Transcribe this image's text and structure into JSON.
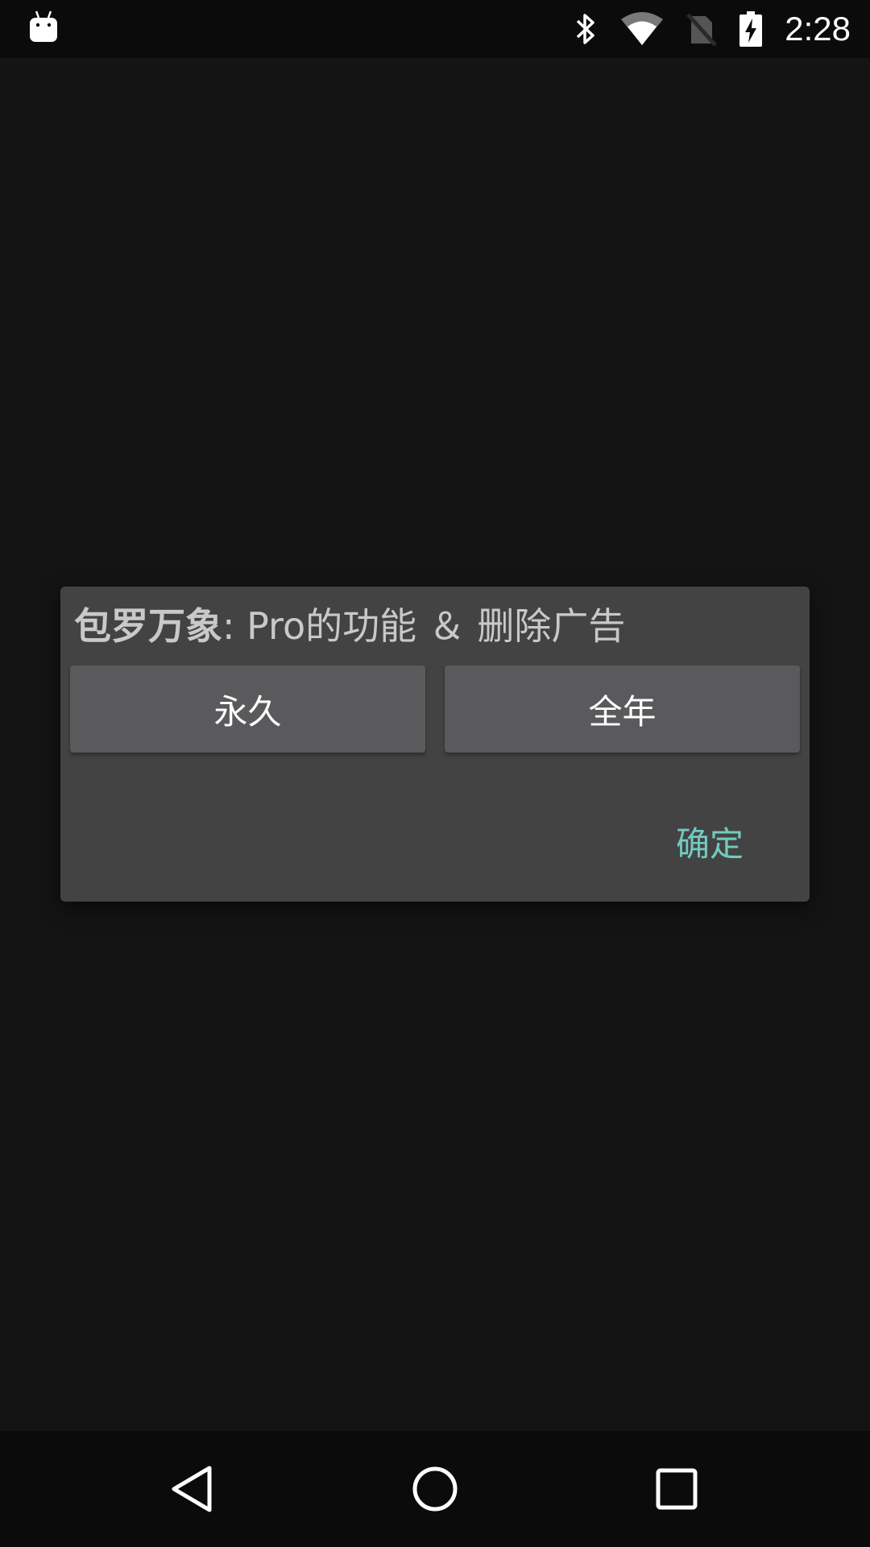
{
  "status_bar": {
    "time": "2:28",
    "icons": [
      "android-notification-icon",
      "bluetooth-icon",
      "wifi-icon",
      "no-sim-icon",
      "battery-charging-icon"
    ]
  },
  "dialog": {
    "title_app": "包罗万象",
    "title_rest": ": Pro的功能 ＆ 删除广告",
    "option_left": "永久",
    "option_right": "全年",
    "confirm": "确定",
    "accent_color": "#72cbbf"
  },
  "nav_bar": {
    "icons": [
      "back-icon",
      "home-icon",
      "recents-icon"
    ]
  }
}
